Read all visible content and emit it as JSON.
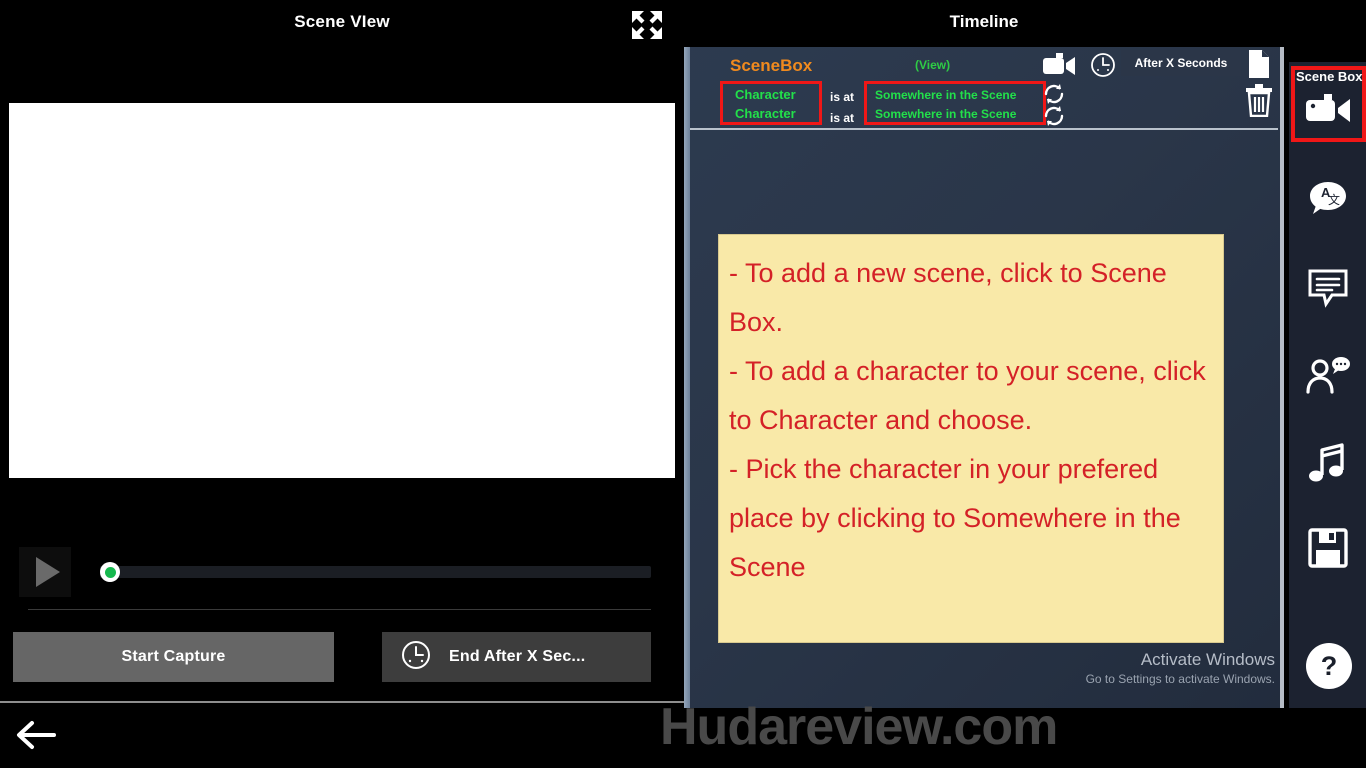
{
  "scene_view": {
    "title": "Scene VIew",
    "expand_icon": "expand-arrows-icon",
    "transport": {
      "play_icon": "play-icon",
      "seek_value": 0,
      "start_capture_label": "Start Capture",
      "end_after_label": "End After X Sec...",
      "end_after_icon": "clock-icon"
    },
    "back_icon": "arrow-left-icon"
  },
  "timeline": {
    "title": "Timeline",
    "scenebox_label": "SceneBox",
    "view_label": "(View)",
    "rows": [
      {
        "character": "Character",
        "connector": "is at",
        "place": "Somewhere in the Scene"
      },
      {
        "character": "Character",
        "connector": "is at",
        "place": "Somewhere in the Scene"
      }
    ],
    "toolbar": {
      "video_icon": "video-camera-icon",
      "clock_icon": "clock-icon",
      "after_x_seconds_label": "After X Seconds",
      "page_icon": "page-icon",
      "refresh_icon": "refresh-icon",
      "trash_icon": "trash-icon"
    },
    "note": "- To add a new scene, click to Scene Box.\n- To add a character to your scene, click to Character and choose.\n- Pick the character in your prefered place by clicking to Somewhere in the Scene"
  },
  "watermarks": {
    "activate_title": "Activate Windows",
    "activate_sub": "Go to Settings to activate Windows.",
    "site": "Hudareview.com"
  },
  "sidebar": {
    "scene_box_label": "Scene Box",
    "items": [
      {
        "name": "scene-box",
        "icon": "video-camera-icon"
      },
      {
        "name": "translate",
        "icon": "translate-bubble-icon"
      },
      {
        "name": "text-bubble",
        "icon": "text-bubble-icon"
      },
      {
        "name": "character-speech",
        "icon": "person-speech-icon"
      },
      {
        "name": "music",
        "icon": "music-note-icon"
      },
      {
        "name": "save",
        "icon": "floppy-disk-icon"
      }
    ],
    "help_label": "?"
  },
  "colors": {
    "accent_orange": "#f08a1e",
    "accent_green": "#22e04a",
    "highlight_red": "#f01717",
    "note_bg": "#f9e9a8",
    "note_text": "#d42127"
  }
}
